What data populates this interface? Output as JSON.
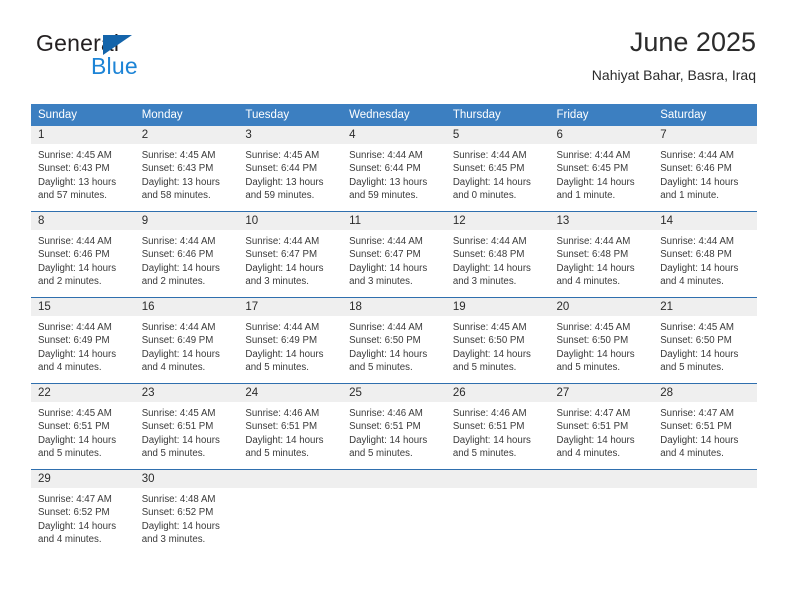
{
  "brand": {
    "word_one": "General",
    "word_two": "Blue",
    "triangle_icon": "triangle-icon"
  },
  "header": {
    "title": "June 2025",
    "subtitle": "Nahiyat Bahar, Basra, Iraq"
  },
  "colors": {
    "header_blue": "#3c7fc1",
    "row_divider_blue": "#2f6fae",
    "daynum_band": "#efefef",
    "brand_dark": "#231f20",
    "brand_blue": "#1d84d6",
    "text": "#2b2b2b"
  },
  "calendar": {
    "weekday_headers": [
      "Sunday",
      "Monday",
      "Tuesday",
      "Wednesday",
      "Thursday",
      "Friday",
      "Saturday"
    ],
    "weeks": [
      [
        {
          "day": "1",
          "sunrise": "Sunrise: 4:45 AM",
          "sunset": "Sunset: 6:43 PM",
          "daylight": "Daylight: 13 hours and 57 minutes."
        },
        {
          "day": "2",
          "sunrise": "Sunrise: 4:45 AM",
          "sunset": "Sunset: 6:43 PM",
          "daylight": "Daylight: 13 hours and 58 minutes."
        },
        {
          "day": "3",
          "sunrise": "Sunrise: 4:45 AM",
          "sunset": "Sunset: 6:44 PM",
          "daylight": "Daylight: 13 hours and 59 minutes."
        },
        {
          "day": "4",
          "sunrise": "Sunrise: 4:44 AM",
          "sunset": "Sunset: 6:44 PM",
          "daylight": "Daylight: 13 hours and 59 minutes."
        },
        {
          "day": "5",
          "sunrise": "Sunrise: 4:44 AM",
          "sunset": "Sunset: 6:45 PM",
          "daylight": "Daylight: 14 hours and 0 minutes."
        },
        {
          "day": "6",
          "sunrise": "Sunrise: 4:44 AM",
          "sunset": "Sunset: 6:45 PM",
          "daylight": "Daylight: 14 hours and 1 minute."
        },
        {
          "day": "7",
          "sunrise": "Sunrise: 4:44 AM",
          "sunset": "Sunset: 6:46 PM",
          "daylight": "Daylight: 14 hours and 1 minute."
        }
      ],
      [
        {
          "day": "8",
          "sunrise": "Sunrise: 4:44 AM",
          "sunset": "Sunset: 6:46 PM",
          "daylight": "Daylight: 14 hours and 2 minutes."
        },
        {
          "day": "9",
          "sunrise": "Sunrise: 4:44 AM",
          "sunset": "Sunset: 6:46 PM",
          "daylight": "Daylight: 14 hours and 2 minutes."
        },
        {
          "day": "10",
          "sunrise": "Sunrise: 4:44 AM",
          "sunset": "Sunset: 6:47 PM",
          "daylight": "Daylight: 14 hours and 3 minutes."
        },
        {
          "day": "11",
          "sunrise": "Sunrise: 4:44 AM",
          "sunset": "Sunset: 6:47 PM",
          "daylight": "Daylight: 14 hours and 3 minutes."
        },
        {
          "day": "12",
          "sunrise": "Sunrise: 4:44 AM",
          "sunset": "Sunset: 6:48 PM",
          "daylight": "Daylight: 14 hours and 3 minutes."
        },
        {
          "day": "13",
          "sunrise": "Sunrise: 4:44 AM",
          "sunset": "Sunset: 6:48 PM",
          "daylight": "Daylight: 14 hours and 4 minutes."
        },
        {
          "day": "14",
          "sunrise": "Sunrise: 4:44 AM",
          "sunset": "Sunset: 6:48 PM",
          "daylight": "Daylight: 14 hours and 4 minutes."
        }
      ],
      [
        {
          "day": "15",
          "sunrise": "Sunrise: 4:44 AM",
          "sunset": "Sunset: 6:49 PM",
          "daylight": "Daylight: 14 hours and 4 minutes."
        },
        {
          "day": "16",
          "sunrise": "Sunrise: 4:44 AM",
          "sunset": "Sunset: 6:49 PM",
          "daylight": "Daylight: 14 hours and 4 minutes."
        },
        {
          "day": "17",
          "sunrise": "Sunrise: 4:44 AM",
          "sunset": "Sunset: 6:49 PM",
          "daylight": "Daylight: 14 hours and 5 minutes."
        },
        {
          "day": "18",
          "sunrise": "Sunrise: 4:44 AM",
          "sunset": "Sunset: 6:50 PM",
          "daylight": "Daylight: 14 hours and 5 minutes."
        },
        {
          "day": "19",
          "sunrise": "Sunrise: 4:45 AM",
          "sunset": "Sunset: 6:50 PM",
          "daylight": "Daylight: 14 hours and 5 minutes."
        },
        {
          "day": "20",
          "sunrise": "Sunrise: 4:45 AM",
          "sunset": "Sunset: 6:50 PM",
          "daylight": "Daylight: 14 hours and 5 minutes."
        },
        {
          "day": "21",
          "sunrise": "Sunrise: 4:45 AM",
          "sunset": "Sunset: 6:50 PM",
          "daylight": "Daylight: 14 hours and 5 minutes."
        }
      ],
      [
        {
          "day": "22",
          "sunrise": "Sunrise: 4:45 AM",
          "sunset": "Sunset: 6:51 PM",
          "daylight": "Daylight: 14 hours and 5 minutes."
        },
        {
          "day": "23",
          "sunrise": "Sunrise: 4:45 AM",
          "sunset": "Sunset: 6:51 PM",
          "daylight": "Daylight: 14 hours and 5 minutes."
        },
        {
          "day": "24",
          "sunrise": "Sunrise: 4:46 AM",
          "sunset": "Sunset: 6:51 PM",
          "daylight": "Daylight: 14 hours and 5 minutes."
        },
        {
          "day": "25",
          "sunrise": "Sunrise: 4:46 AM",
          "sunset": "Sunset: 6:51 PM",
          "daylight": "Daylight: 14 hours and 5 minutes."
        },
        {
          "day": "26",
          "sunrise": "Sunrise: 4:46 AM",
          "sunset": "Sunset: 6:51 PM",
          "daylight": "Daylight: 14 hours and 5 minutes."
        },
        {
          "day": "27",
          "sunrise": "Sunrise: 4:47 AM",
          "sunset": "Sunset: 6:51 PM",
          "daylight": "Daylight: 14 hours and 4 minutes."
        },
        {
          "day": "28",
          "sunrise": "Sunrise: 4:47 AM",
          "sunset": "Sunset: 6:51 PM",
          "daylight": "Daylight: 14 hours and 4 minutes."
        }
      ],
      [
        {
          "day": "29",
          "sunrise": "Sunrise: 4:47 AM",
          "sunset": "Sunset: 6:52 PM",
          "daylight": "Daylight: 14 hours and 4 minutes."
        },
        {
          "day": "30",
          "sunrise": "Sunrise: 4:48 AM",
          "sunset": "Sunset: 6:52 PM",
          "daylight": "Daylight: 14 hours and 3 minutes."
        },
        {
          "day": "",
          "sunrise": "",
          "sunset": "",
          "daylight": ""
        },
        {
          "day": "",
          "sunrise": "",
          "sunset": "",
          "daylight": ""
        },
        {
          "day": "",
          "sunrise": "",
          "sunset": "",
          "daylight": ""
        },
        {
          "day": "",
          "sunrise": "",
          "sunset": "",
          "daylight": ""
        },
        {
          "day": "",
          "sunrise": "",
          "sunset": "",
          "daylight": ""
        }
      ]
    ]
  }
}
